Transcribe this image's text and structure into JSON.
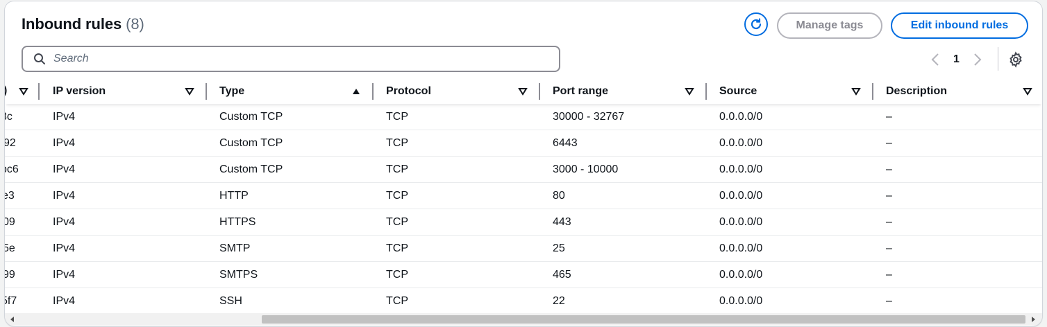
{
  "header": {
    "title": "Inbound rules",
    "count": "(8)",
    "manage_tags_label": "Manage tags",
    "edit_rules_label": "Edit inbound rules"
  },
  "search": {
    "placeholder": "Search",
    "value": ""
  },
  "pagination": {
    "current_page": "1"
  },
  "table": {
    "columns": [
      {
        "label": "",
        "sort": "none"
      },
      {
        "label": "IP version",
        "sort": "none"
      },
      {
        "label": "Type",
        "sort": "ascending"
      },
      {
        "label": "Protocol",
        "sort": "none"
      },
      {
        "label": "Port range",
        "sort": "none"
      },
      {
        "label": "Source",
        "sort": "none"
      },
      {
        "label": "Description",
        "sort": "none"
      }
    ],
    "rows": [
      {
        "id_suffix": "3c",
        "ip_version": "IPv4",
        "type": "Custom TCP",
        "protocol": "TCP",
        "port_range": "30000 - 32767",
        "source": "0.0.0.0/0",
        "description": "–"
      },
      {
        "id_suffix": "92",
        "ip_version": "IPv4",
        "type": "Custom TCP",
        "protocol": "TCP",
        "port_range": "6443",
        "source": "0.0.0.0/0",
        "description": "–"
      },
      {
        "id_suffix": "bc6",
        "ip_version": "IPv4",
        "type": "Custom TCP",
        "protocol": "TCP",
        "port_range": "3000 - 10000",
        "source": "0.0.0.0/0",
        "description": "–"
      },
      {
        "id_suffix": "e3",
        "ip_version": "IPv4",
        "type": "HTTP",
        "protocol": "TCP",
        "port_range": "80",
        "source": "0.0.0.0/0",
        "description": "–"
      },
      {
        "id_suffix": "09",
        "ip_version": "IPv4",
        "type": "HTTPS",
        "protocol": "TCP",
        "port_range": "443",
        "source": "0.0.0.0/0",
        "description": "–"
      },
      {
        "id_suffix": "5e",
        "ip_version": "IPv4",
        "type": "SMTP",
        "protocol": "TCP",
        "port_range": "25",
        "source": "0.0.0.0/0",
        "description": "–"
      },
      {
        "id_suffix": "99",
        "ip_version": "IPv4",
        "type": "SMTPS",
        "protocol": "TCP",
        "port_range": "465",
        "source": "0.0.0.0/0",
        "description": "–"
      },
      {
        "id_suffix": "5f7",
        "ip_version": "IPv4",
        "type": "SSH",
        "protocol": "TCP",
        "port_range": "22",
        "source": "0.0.0.0/0",
        "description": "–"
      }
    ]
  },
  "icons": {
    "refresh": "refresh-icon",
    "search": "search-icon",
    "prev": "chevron-left-icon",
    "next": "chevron-right-icon",
    "settings": "gear-icon",
    "sort_desc": "caret-down-outline-icon",
    "sort_asc": "caret-up-filled-icon"
  },
  "colors": {
    "accent": "#006ce0",
    "disabled": "#8c8c94",
    "text": "#0f141a",
    "muted": "#5f6b7a"
  }
}
